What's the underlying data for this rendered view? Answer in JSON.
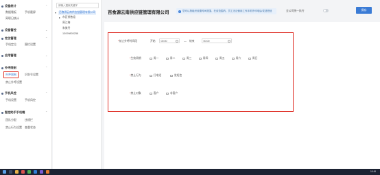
{
  "sidebar": {
    "sections": [
      {
        "title": "设备统计",
        "items": [
          "数据看板",
          "手机截屏",
          "离职日统计"
        ]
      },
      {
        "title": "设备管控"
      },
      {
        "title": "定位管理",
        "items": [
          "手机定位",
          "围栏设置"
        ]
      },
      {
        "title": "应用管理"
      },
      {
        "title": "外呼限制",
        "items": [
          "外呼限制",
          "识别号设置",
          "禁止外呼设置"
        ]
      },
      {
        "title": "手机风控",
        "items": [
          "手机设置",
          "手机风控"
        ]
      },
      {
        "title": "智控助手手机端",
        "items": [
          "团队分配",
          "违规拦",
          "禁止行为设置",
          "查重状态"
        ]
      }
    ]
  },
  "tree": {
    "search_placeholder": "请输入搜索关键字",
    "nodes": [
      "百食源云南供应链管理有限公司",
      "市区销售组",
      "周江梅",
      "朱美丹",
      "13099800258"
    ]
  },
  "header": {
    "page_title": "百食源云南供应链管理有限公司",
    "notice": "您可以按组织设置时间范围，在该范围内，员工无法使用工作手机外呼电话/发送短信",
    "fixed_label": "全公司统一执行",
    "save_label": "保存"
  },
  "form": {
    "time_label": "禁止外呼时间段",
    "start_label": "开始",
    "start_time": "00:00",
    "dash": "—",
    "end_label": "结束",
    "end_time": "00:00",
    "week_label": "生效周期",
    "weekdays": [
      "周一",
      "周二",
      "周三",
      "周四",
      "周五",
      "周六",
      "周日"
    ],
    "behavior_label": "禁止行为",
    "behaviors": [
      "打电话",
      "发短信"
    ],
    "target_label": "禁止对象",
    "targets": [
      "客户",
      "非客户"
    ]
  },
  "taskbar": {
    "clock": "10:49"
  },
  "colors": {
    "accent": "#3a7bd5",
    "highlight_border": "#e0342c",
    "taskbar": "#1c2333"
  }
}
